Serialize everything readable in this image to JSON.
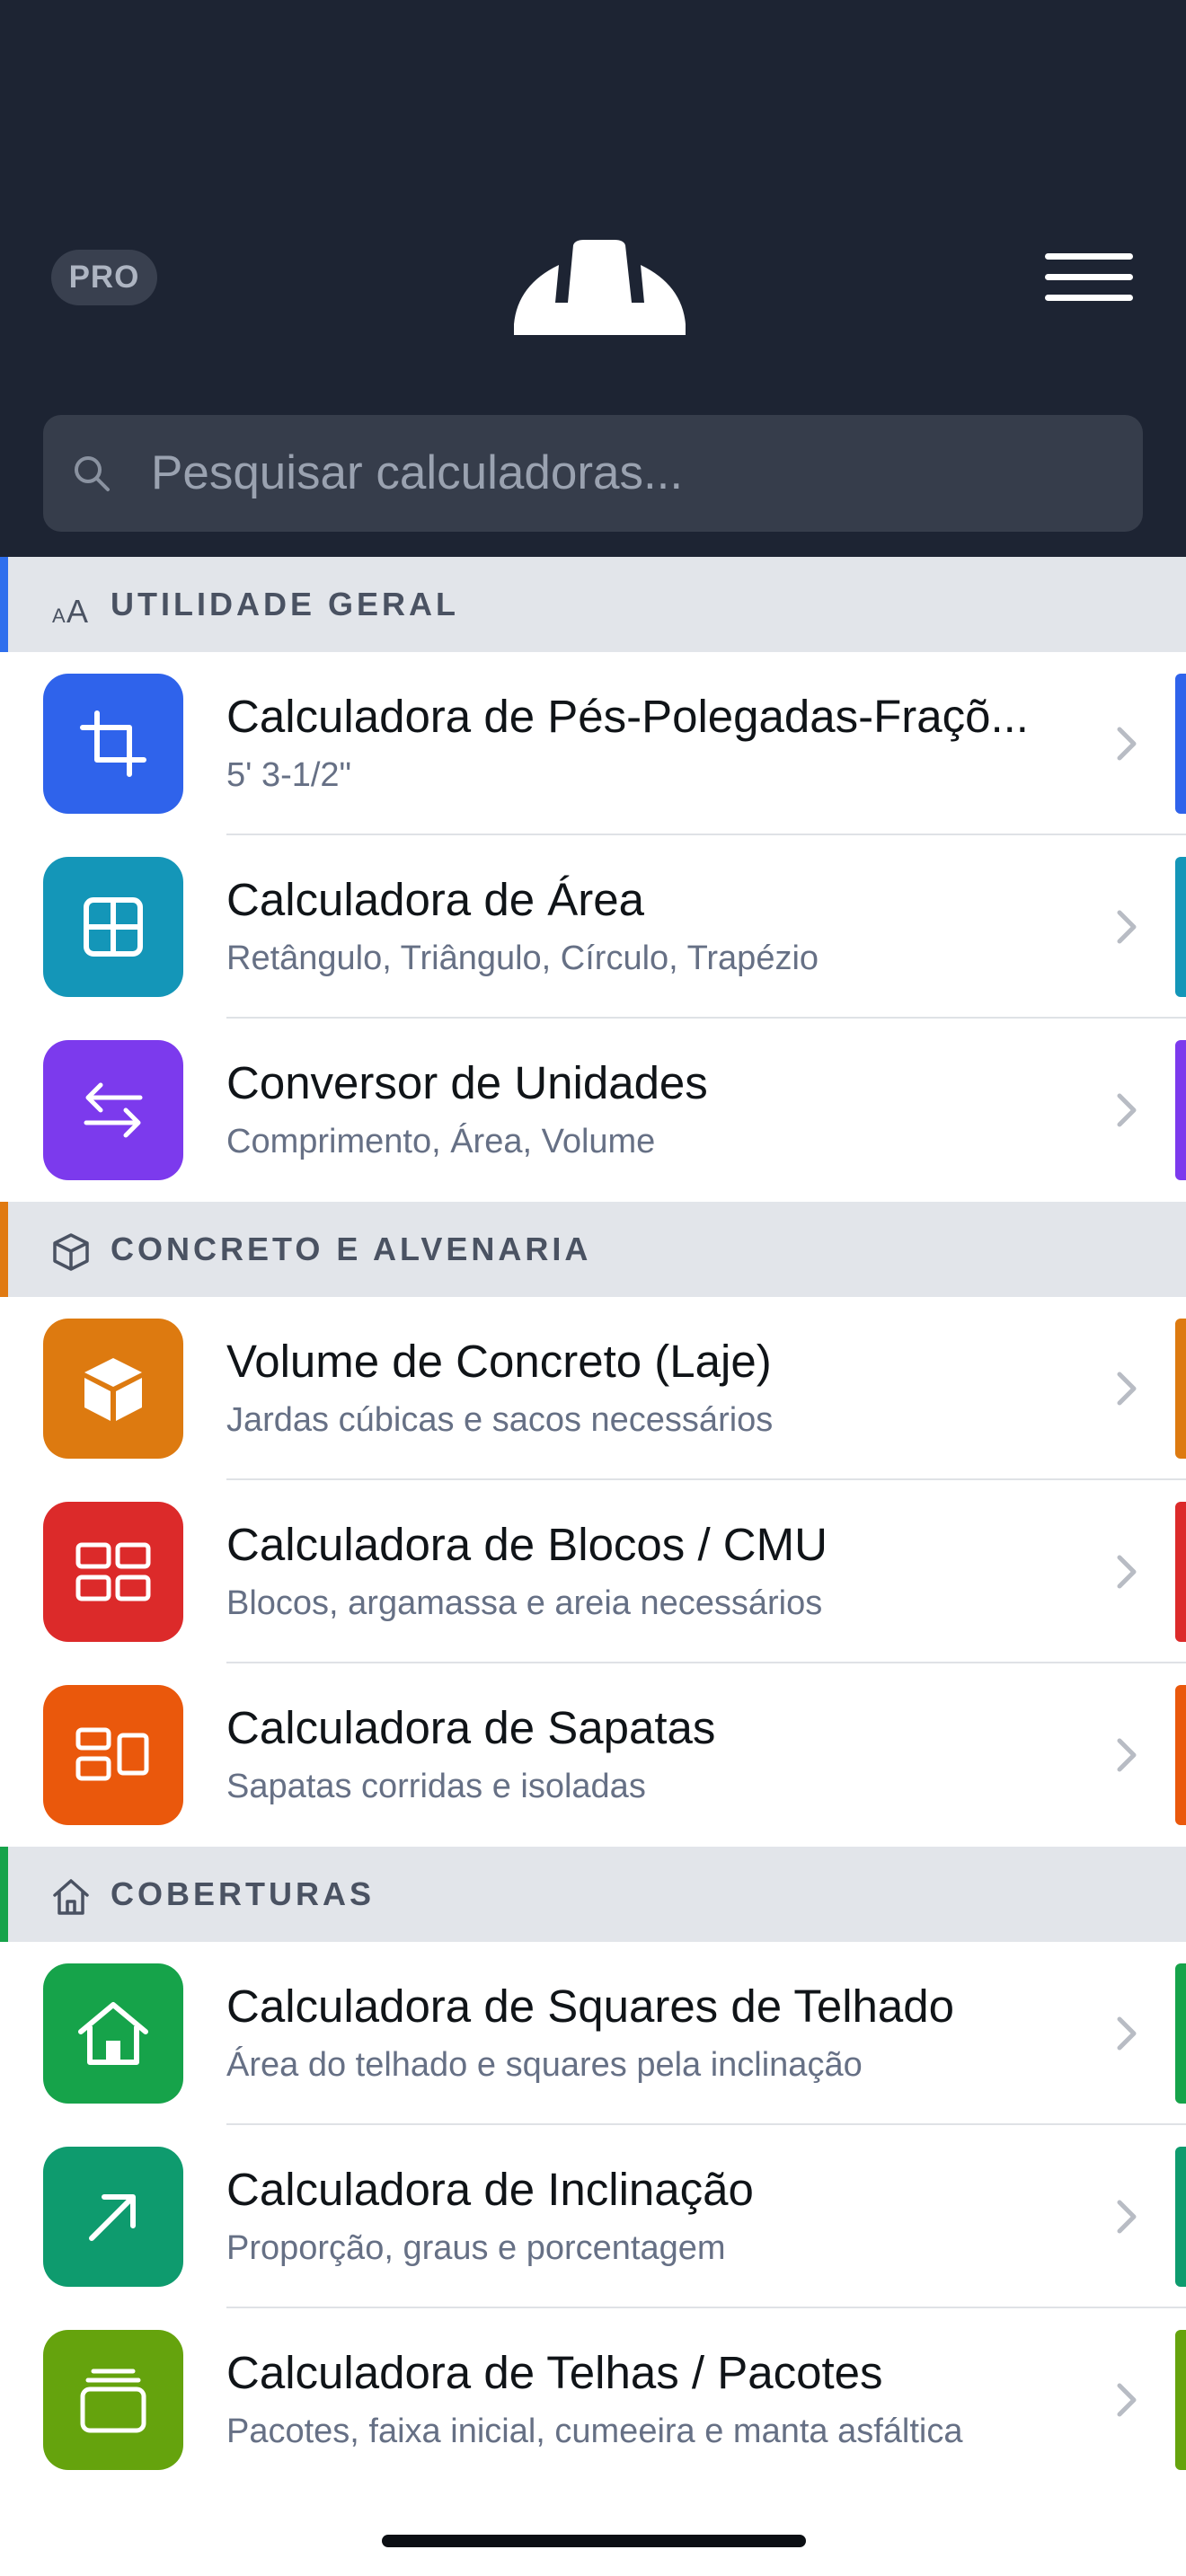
{
  "header": {
    "pro_label": "PRO",
    "logo_icon": "hard-hat-icon",
    "menu_icon": "hamburger-menu-icon",
    "search_placeholder": "Pesquisar calculadoras..."
  },
  "sections": [
    {
      "title": "UTILIDADE GERAL",
      "icon": "text-size-icon",
      "accent": "#2f6fed",
      "items": [
        {
          "title": "Calculadora de Pés-Polegadas-Fraçõ...",
          "subtitle": "5' 3-1/2\"",
          "icon": "crop-icon",
          "color": "#2f63eb"
        },
        {
          "title": "Calculadora de Área",
          "subtitle": "Retângulo, Triângulo, Círculo, Trapézio",
          "icon": "grid-icon",
          "color": "#1496b8"
        },
        {
          "title": "Conversor de Unidades",
          "subtitle": "Comprimento, Área, Volume",
          "icon": "swap-arrows-icon",
          "color": "#7c3aed"
        }
      ]
    },
    {
      "title": "CONCRETO E ALVENARIA",
      "icon": "cube-icon",
      "accent": "#e07a12",
      "items": [
        {
          "title": "Volume de Concreto (Laje)",
          "subtitle": "Jardas cúbicas e sacos necessários",
          "icon": "box-icon",
          "color": "#dd7a10"
        },
        {
          "title": "Calculadora de Blocos / CMU",
          "subtitle": "Blocos, argamassa e areia necessários",
          "icon": "blocks-icon",
          "color": "#dc2a2a"
        },
        {
          "title": "Calculadora de Sapatas",
          "subtitle": "Sapatas corridas e isoladas",
          "icon": "footing-icon",
          "color": "#ea580c"
        }
      ]
    },
    {
      "title": "COBERTURAS",
      "icon": "house-icon",
      "accent": "#16a34a",
      "items": [
        {
          "title": "Calculadora de Squares de Telhado",
          "subtitle": "Área do telhado e squares pela inclinação",
          "icon": "house-icon",
          "color": "#16a34a"
        },
        {
          "title": "Calculadora de Inclinação",
          "subtitle": "Proporção, graus e porcentagem",
          "icon": "arrow-up-right-icon",
          "color": "#0e9b6e"
        },
        {
          "title": "Calculadora de Telhas / Pacotes",
          "subtitle": "Pacotes, faixa inicial, cumeeira e manta asfáltica",
          "icon": "stack-icon",
          "color": "#65a30d"
        }
      ]
    }
  ]
}
